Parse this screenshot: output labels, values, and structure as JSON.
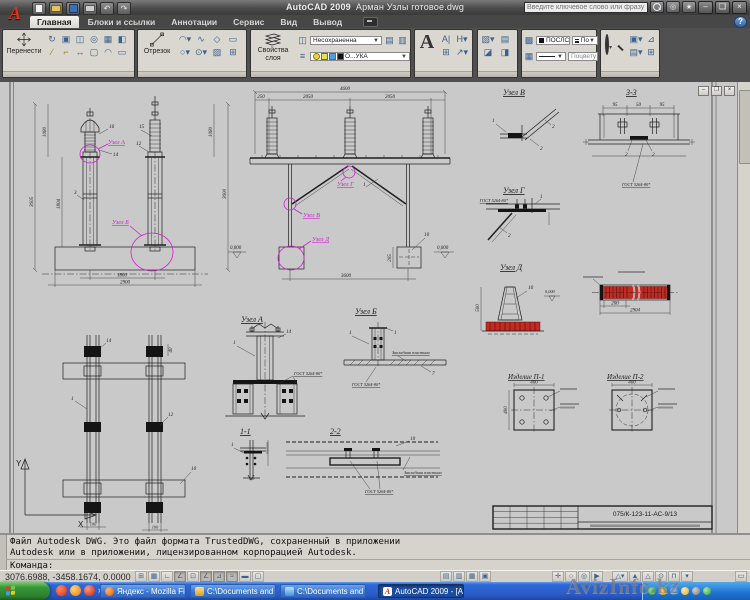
{
  "titlebar": {
    "app_title": "AutoCAD 2009",
    "doc_title": "Арман Узлы готовое.dwg",
    "search_placeholder": "Введите ключевое слово или фразу"
  },
  "tabs": [
    "Главная",
    "Блоки и ссылки",
    "Аннотации",
    "Сервис",
    "Вид",
    "Вывод"
  ],
  "ribbon": {
    "move": "Перенести",
    "line": "Отрезок",
    "layers1": "Свойства",
    "layers2": "слоя",
    "layer_filter": "Несохраненна",
    "layer_name": "О...УКА",
    "text_icon": "A",
    "color": "ПОСЛС",
    "lineweight": "По",
    "plot_style": "Поцвету"
  },
  "canvas": {
    "labels": {
      "uzel_a": "Узел А",
      "uzel_b": "Узел Б",
      "uzel_v": "Узел В",
      "uzel_g": "Узел Г",
      "uzel_d": "Узел Д",
      "s33": "3-3",
      "s11": "1-1",
      "s22": "2-2",
      "p1": "Изделие П-1",
      "p2": "Изделие П-2",
      "gost": "ГОСТ 5264-80*",
      "plate": "Закладная пластина",
      "tb_code": "075/К-123-11-АС-9/13",
      "ax": "X",
      "ay": "Y",
      "level": "0,000"
    },
    "dims": {
      "d4600": "4600",
      "d250": "250",
      "d2050": "2050",
      "d3605": "3605",
      "d1080": "1080",
      "d3600": "3600",
      "d1804": "1804",
      "d1800": "1800",
      "d2900": "2900",
      "d2904": "2904",
      "d200": "200",
      "d205": "205",
      "d500": "500",
      "d95": "95",
      "d50": "50",
      "d400": "400",
      "d100": "100",
      "d40": "40"
    },
    "items": {
      "n1": "1",
      "n2": "2",
      "n3": "3",
      "n7": "7",
      "n10": "10",
      "n12": "12",
      "n14": "14",
      "n15": "15",
      "n16": "16"
    }
  },
  "command": {
    "line1": "Файл Autodesk DWG. Это файл формата TrustedDWG, сохраненный в приложении",
    "line2": "Autodesk или в приложении, лицензированном корпорацией Autodesk.",
    "prompt": "Команда:"
  },
  "status": {
    "coords": "3076.6988, -3458.1674, 0.0000"
  },
  "taskbar": {
    "tasks": [
      "Яндекс - Mozilla Firefox",
      "C:\\Documents and Sett...",
      "C:\\Documents and Sett...",
      "AutoCAD 2009 - [Арм..."
    ]
  },
  "watermark": "AvizInfo.kz"
}
